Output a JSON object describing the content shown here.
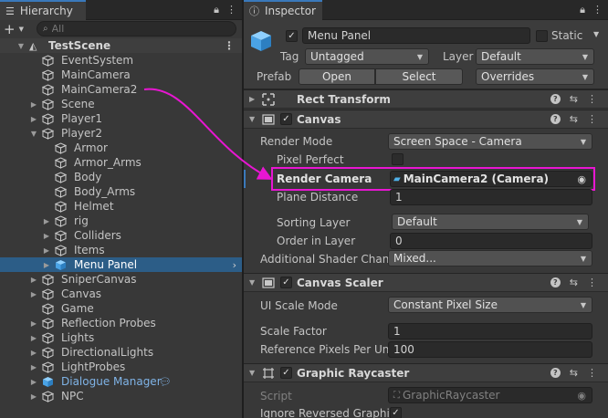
{
  "hierarchy": {
    "tab_title": "Hierarchy",
    "add_label": "+",
    "search_placeholder": "All",
    "items": [
      {
        "label": "TestScene",
        "depth": 0,
        "arrow": "down",
        "kind": "scene"
      },
      {
        "label": "EventSystem",
        "depth": 1,
        "arrow": "none"
      },
      {
        "label": "MainCamera",
        "depth": 1,
        "arrow": "none"
      },
      {
        "label": "MainCamera2",
        "depth": 1,
        "arrow": "none"
      },
      {
        "label": "Scene",
        "depth": 1,
        "arrow": "right"
      },
      {
        "label": "Player1",
        "depth": 1,
        "arrow": "right"
      },
      {
        "label": "Player2",
        "depth": 1,
        "arrow": "down"
      },
      {
        "label": "Armor",
        "depth": 2,
        "arrow": "none"
      },
      {
        "label": "Armor_Arms",
        "depth": 2,
        "arrow": "none"
      },
      {
        "label": "Body",
        "depth": 2,
        "arrow": "none"
      },
      {
        "label": "Body_Arms",
        "depth": 2,
        "arrow": "none"
      },
      {
        "label": "Helmet",
        "depth": 2,
        "arrow": "none"
      },
      {
        "label": "rig",
        "depth": 2,
        "arrow": "right"
      },
      {
        "label": "Colliders",
        "depth": 2,
        "arrow": "right"
      },
      {
        "label": "Items",
        "depth": 2,
        "arrow": "right"
      },
      {
        "label": "Menu Panel",
        "depth": 2,
        "arrow": "right",
        "kind": "selected"
      },
      {
        "label": "SniperCanvas",
        "depth": 1,
        "arrow": "right"
      },
      {
        "label": "Canvas",
        "depth": 1,
        "arrow": "right"
      },
      {
        "label": "Game",
        "depth": 1,
        "arrow": "none"
      },
      {
        "label": "Reflection Probes",
        "depth": 1,
        "arrow": "right"
      },
      {
        "label": "Lights",
        "depth": 1,
        "arrow": "right"
      },
      {
        "label": "DirectionalLights",
        "depth": 1,
        "arrow": "right"
      },
      {
        "label": "LightProbes",
        "depth": 1,
        "arrow": "right"
      },
      {
        "label": "Dialogue Manager",
        "depth": 1,
        "arrow": "right",
        "kind": "prefab"
      },
      {
        "label": "NPC",
        "depth": 1,
        "arrow": "right"
      }
    ]
  },
  "inspector": {
    "tab_title": "Inspector",
    "object_name": "Menu Panel",
    "static_label": "Static",
    "tag_label": "Tag",
    "tag_value": "Untagged",
    "layer_label": "Layer",
    "layer_value": "Default",
    "prefab_label": "Prefab",
    "open_label": "Open",
    "select_label": "Select",
    "overrides_label": "Overrides",
    "rect_transform": {
      "title": "Rect Transform"
    },
    "canvas": {
      "title": "Canvas",
      "render_mode_label": "Render Mode",
      "render_mode_value": "Screen Space - Camera",
      "pixel_perfect_label": "Pixel Perfect",
      "render_camera_label": "Render Camera",
      "render_camera_value": "MainCamera2 (Camera)",
      "plane_distance_label": "Plane Distance",
      "plane_distance_value": "1",
      "sorting_layer_label": "Sorting Layer",
      "sorting_layer_value": "Default",
      "order_in_layer_label": "Order in Layer",
      "order_in_layer_value": "0",
      "shader_channels_label": "Additional Shader Chann",
      "shader_channels_value": "Mixed..."
    },
    "canvas_scaler": {
      "title": "Canvas Scaler",
      "ui_scale_mode_label": "UI Scale Mode",
      "ui_scale_mode_value": "Constant Pixel Size",
      "scale_factor_label": "Scale Factor",
      "scale_factor_value": "1",
      "ref_pixels_label": "Reference Pixels Per Uni",
      "ref_pixels_value": "100"
    },
    "graphic_raycaster": {
      "title": "Graphic Raycaster",
      "script_label": "Script",
      "script_value": "GraphicRaycaster",
      "ignore_reversed_label": "Ignore Reversed Graphic"
    }
  },
  "colors": {
    "accent_blue": "#3a79bb",
    "selection": "#2c5d87",
    "highlight": "#e816d2",
    "prefab_text": "#7fb3e6"
  }
}
